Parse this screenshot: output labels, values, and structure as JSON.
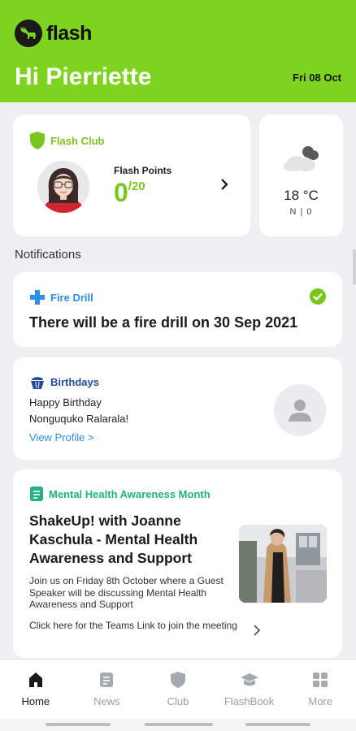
{
  "header": {
    "app_name": "flash",
    "greeting": "Hi Pierriette",
    "date": "Fri 08 Oct",
    "bg_color": "#7ed321"
  },
  "club": {
    "title": "Flash Club",
    "points_label": "Flash Points",
    "points": "0",
    "points_max": "/20"
  },
  "weather": {
    "icon": "partly-cloudy-icon",
    "temp": "18 °C",
    "wind": "N | 0"
  },
  "notifications": {
    "section_label": "Notifications",
    "fire_drill": {
      "category": "Fire Drill",
      "title": "There will be a fire drill on 30 Sep 2021"
    },
    "birthdays": {
      "category": "Birthdays",
      "line1": "Happy Birthday",
      "line2": "Nonguquko Ralarala!",
      "link": "View Profile >"
    },
    "mental_health": {
      "category": "Mental Health Awareness Month",
      "title": "ShakeUp! with Joanne Kaschula - Mental Health Awareness and Support",
      "body": "Join us on Friday 8th October where a Guest Speaker will be discussing Mental Health Awareness and Support",
      "link": "Click here for the Teams Link to join the meeting"
    }
  },
  "bottom_nav": {
    "items": [
      {
        "label": "Home",
        "icon": "home-icon",
        "active": true
      },
      {
        "label": "News",
        "icon": "news-icon",
        "active": false
      },
      {
        "label": "Club",
        "icon": "shield-icon",
        "active": false
      },
      {
        "label": "FlashBook",
        "icon": "graduation-cap-icon",
        "active": false
      },
      {
        "label": "More",
        "icon": "grid-icon",
        "active": false
      }
    ]
  }
}
